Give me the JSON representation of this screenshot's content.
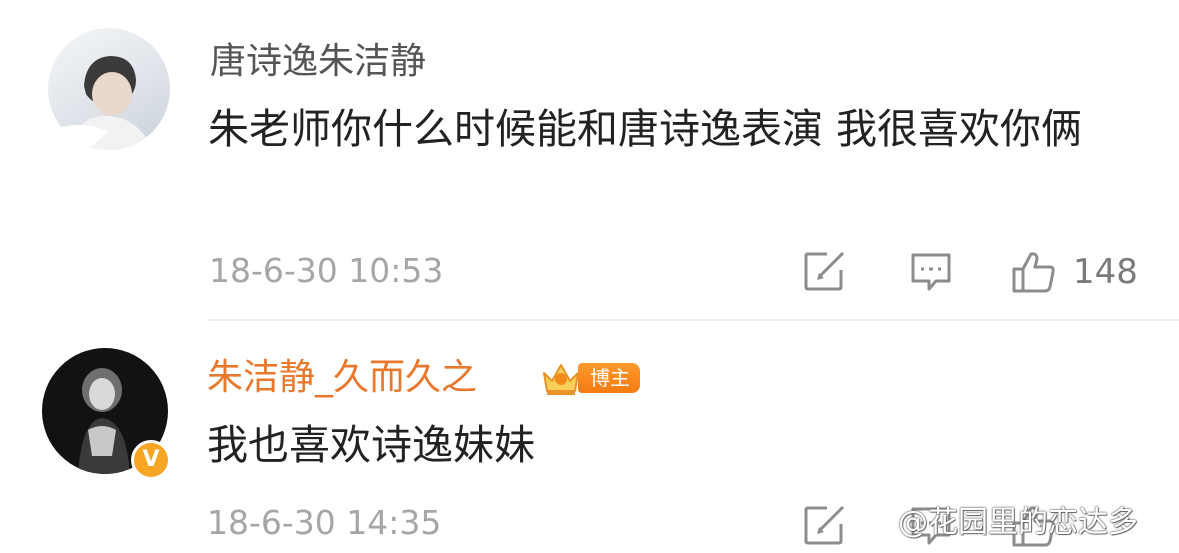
{
  "comments": [
    {
      "username": "唐诗逸朱洁静",
      "text": "朱老师你什么时候能和唐诗逸表演 我很喜欢你俩",
      "time": "18-6-30 10:53",
      "like_count": "148",
      "avatar_icon": "avatar-photo"
    },
    {
      "username": "朱洁静_久而久之",
      "badge_label": "博主",
      "vip_label": "V",
      "text": "我也喜欢诗逸妹妹",
      "time": "18-6-30 14:35",
      "avatar_icon": "avatar-photo"
    }
  ],
  "watermark": "@花园里的恋达多",
  "colors": {
    "vip_username": "#e8782c",
    "badge": "#f57a12",
    "meta_text": "#a6a6a6"
  }
}
